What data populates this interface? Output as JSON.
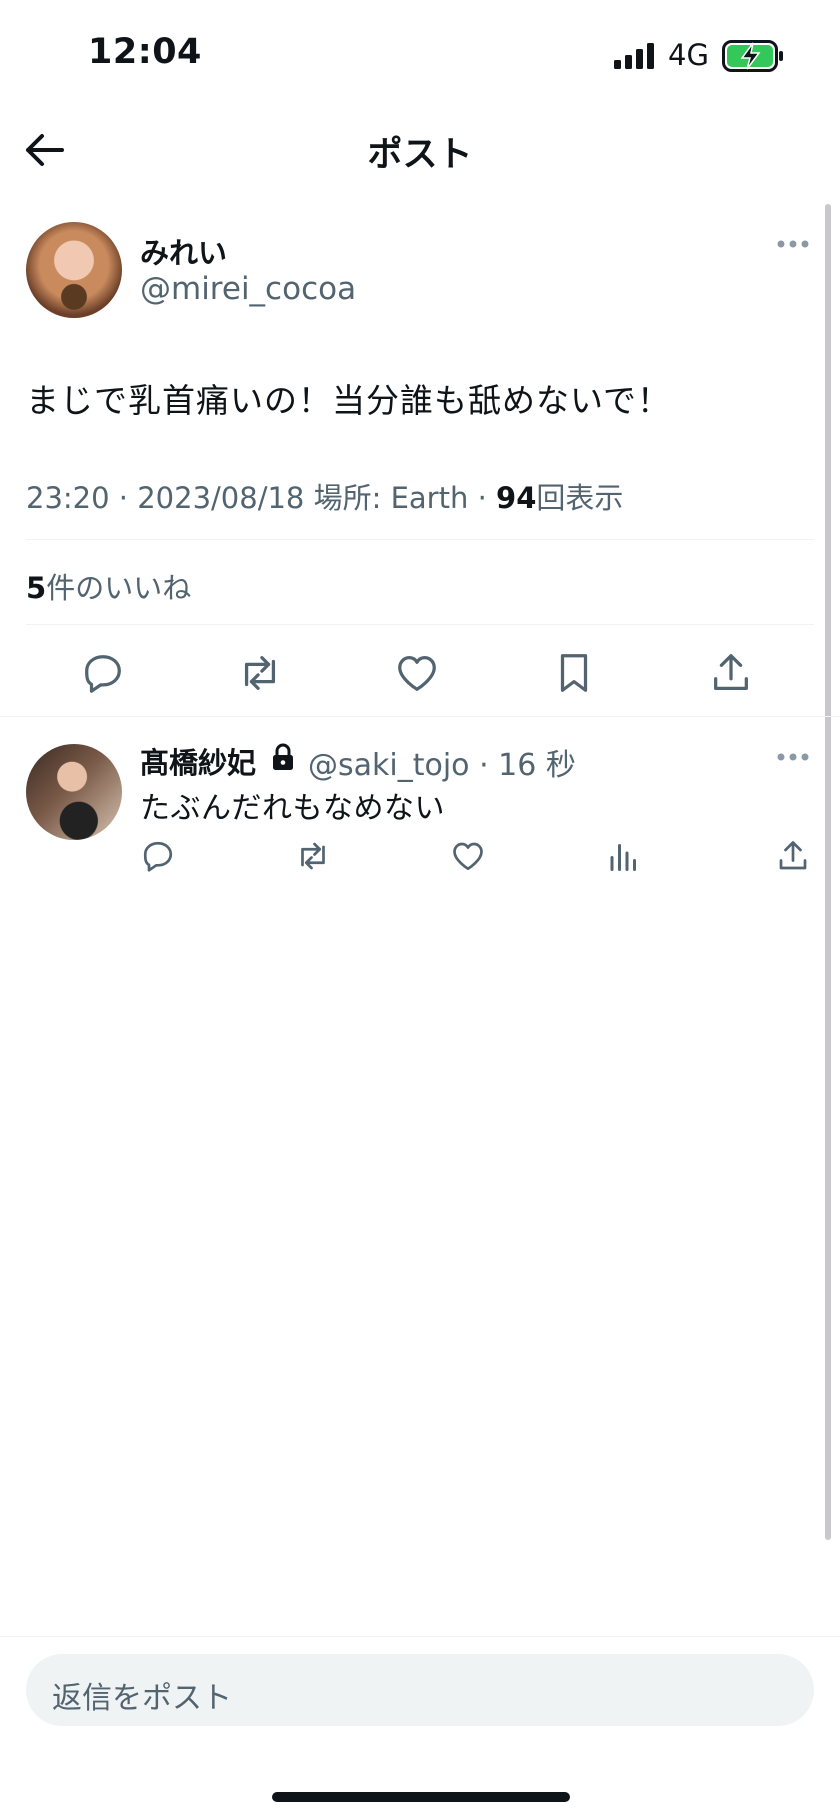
{
  "status_bar": {
    "time": "12:04",
    "network": "4G",
    "icons": [
      "signal-icon",
      "battery-charging-icon"
    ],
    "battery_color": "#34c759"
  },
  "header": {
    "title": "ポスト",
    "back_icon": "arrow-left-icon"
  },
  "post": {
    "author_name": "みれい",
    "author_handle": "@mirei_cocoa",
    "text": "まじで乳首痛いの！当分誰も舐めないで！",
    "timestamp": "23:20 · 2023/08/18",
    "location_label": "場所: Earth",
    "views_count": "94",
    "views_label": "回表示",
    "likes_count": "5",
    "likes_label": "件のいいね",
    "actions": [
      "reply-icon",
      "repost-icon",
      "like-icon",
      "bookmark-icon",
      "share-icon"
    ]
  },
  "reply": {
    "author_name": "髙橋紗妃",
    "author_handle": "@saki_tojo",
    "time_ago": "16 秒",
    "text": "たぶんだれもなめない",
    "protected": true,
    "actions": [
      "reply-icon",
      "repost-icon",
      "like-icon",
      "views-icon",
      "share-icon"
    ]
  },
  "composer": {
    "placeholder": "返信をポスト"
  },
  "colors": {
    "text_primary": "#0f1419",
    "text_secondary": "#536471",
    "divider": "#eff3f4"
  }
}
